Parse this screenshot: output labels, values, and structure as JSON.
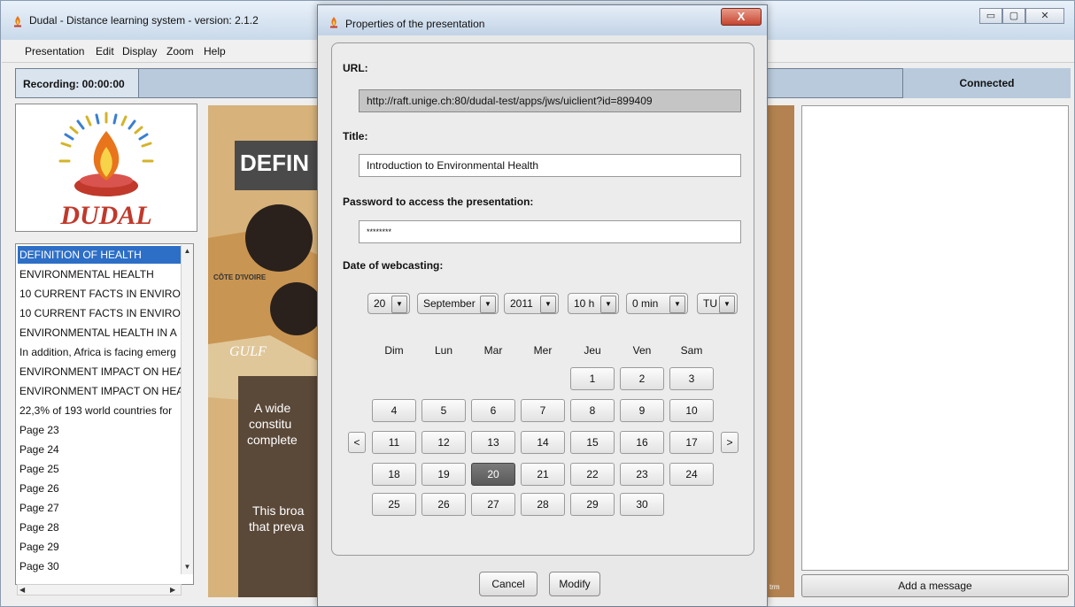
{
  "window": {
    "title": "Dudal - Distance learning system - version: 2.1.2",
    "controls": [
      "▭",
      "▢",
      "✕"
    ]
  },
  "menu": [
    "Presentation",
    "Edit",
    "Display",
    "Zoom",
    "Help"
  ],
  "status": {
    "recording": "Recording: 00:00:00",
    "connection": "Connected"
  },
  "logo": {
    "text": "DUDAL"
  },
  "slides": [
    "DEFINITION OF HEALTH",
    "ENVIRONMENTAL HEALTH",
    "10 CURRENT FACTS IN ENVIRO",
    "10 CURRENT FACTS IN ENVIRO",
    "ENVIRONMENTAL HEALTH IN A",
    "In addition, Africa is facing emerg",
    "ENVIRONMENT IMPACT ON HEA",
    "ENVIRONMENT IMPACT ON HEA",
    "22,3% of 193 world countries for",
    "Page 23",
    "Page 24",
    "Page 25",
    "Page 26",
    "Page 27",
    "Page 28",
    "Page 29",
    "Page 30"
  ],
  "slide_preview": {
    "heading": "DEFIN",
    "text1": "A wide",
    "text2": "constitu",
    "text3": "complete",
    "text4": "This broa",
    "text5": "that preva",
    "map_label1": "CÔTE D'IVOIRE",
    "map_label2": "GULF",
    "corner": "trm"
  },
  "chat": {
    "add_message": "Add a message"
  },
  "dialog": {
    "title": "Properties of the presentation",
    "close": "X",
    "url_label": "URL:",
    "url_value": "http://raft.unige.ch:80/dudal-test/apps/jws/uiclient?id=899409",
    "title_label": "Title:",
    "title_value": "Introduction to Environmental Health",
    "password_label": "Password to access the presentation:",
    "password_value": "********",
    "date_label": "Date of webcasting:",
    "day_value": "20",
    "month_value": "September",
    "year_value": "2011",
    "hour_value": "10 h",
    "minute_value": "0 min",
    "tz_value": "TU",
    "weekdays": [
      "Dim",
      "Lun",
      "Mar",
      "Mer",
      "Jeu",
      "Ven",
      "Sam"
    ],
    "weeks": [
      [
        "",
        "",
        "",
        "",
        "1",
        "2",
        "3"
      ],
      [
        "4",
        "5",
        "6",
        "7",
        "8",
        "9",
        "10"
      ],
      [
        "11",
        "12",
        "13",
        "14",
        "15",
        "16",
        "17"
      ],
      [
        "18",
        "19",
        "20",
        "21",
        "22",
        "23",
        "24"
      ],
      [
        "25",
        "26",
        "27",
        "28",
        "29",
        "30",
        ""
      ]
    ],
    "selected_day": "20",
    "prev_month": "<",
    "next_month": ">",
    "cancel": "Cancel",
    "modify": "Modify"
  },
  "colors": {
    "selection": "#2d6fc7",
    "status_bar": "#b8cadc",
    "close_button": "#c5452f"
  }
}
